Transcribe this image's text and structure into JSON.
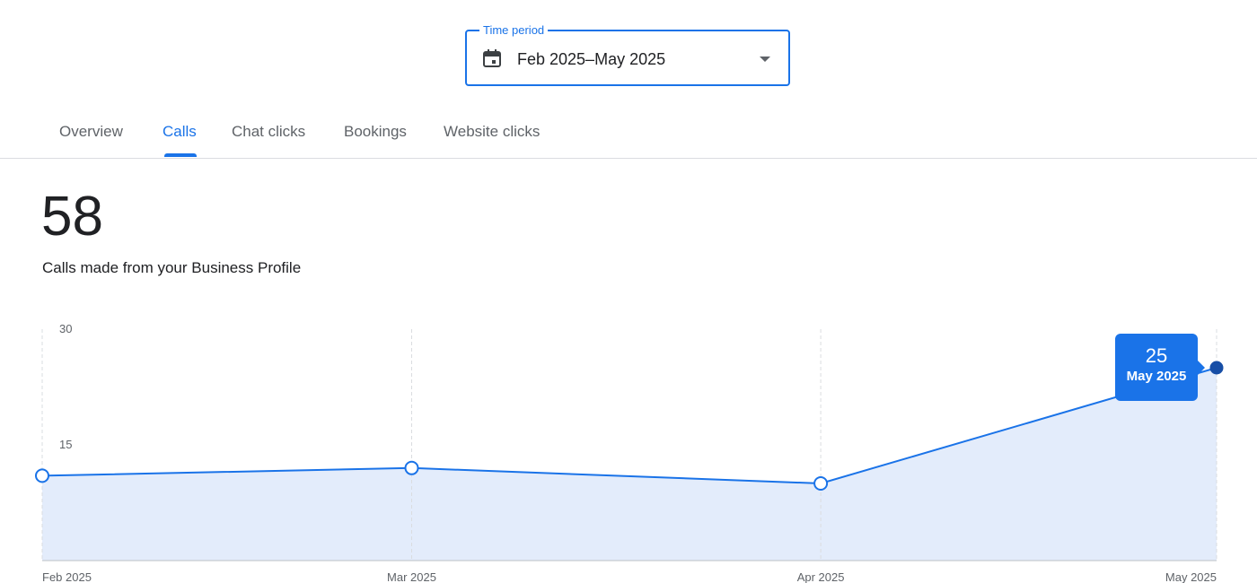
{
  "period": {
    "legend": "Time period",
    "value": "Feb 2025–May 2025",
    "icon": "calendar-icon"
  },
  "tabs": [
    {
      "label": "Overview",
      "active": false
    },
    {
      "label": "Calls",
      "active": true
    },
    {
      "label": "Chat clicks",
      "active": false
    },
    {
      "label": "Bookings",
      "active": false
    },
    {
      "label": "Website clicks",
      "active": false
    }
  ],
  "summary": {
    "value": "58",
    "caption": "Calls made from your Business Profile"
  },
  "tooltip": {
    "value": "25",
    "label": "May 2025"
  },
  "colors": {
    "accent": "#1a73e8",
    "area_fill": "#e3ecfb",
    "last_point": "#174ea6"
  },
  "chart_data": {
    "type": "area",
    "categories": [
      "Feb 2025",
      "Mar 2025",
      "Apr 2025",
      "May 2025"
    ],
    "x_dates": [
      "2025-02-01",
      "2025-03-01",
      "2025-04-01",
      "2025-05-01"
    ],
    "values": [
      11,
      12,
      10,
      25
    ],
    "yticks": [
      15,
      30
    ],
    "ylim": [
      0,
      30
    ],
    "grid": "vertical dashed",
    "highlight_index": 3
  }
}
